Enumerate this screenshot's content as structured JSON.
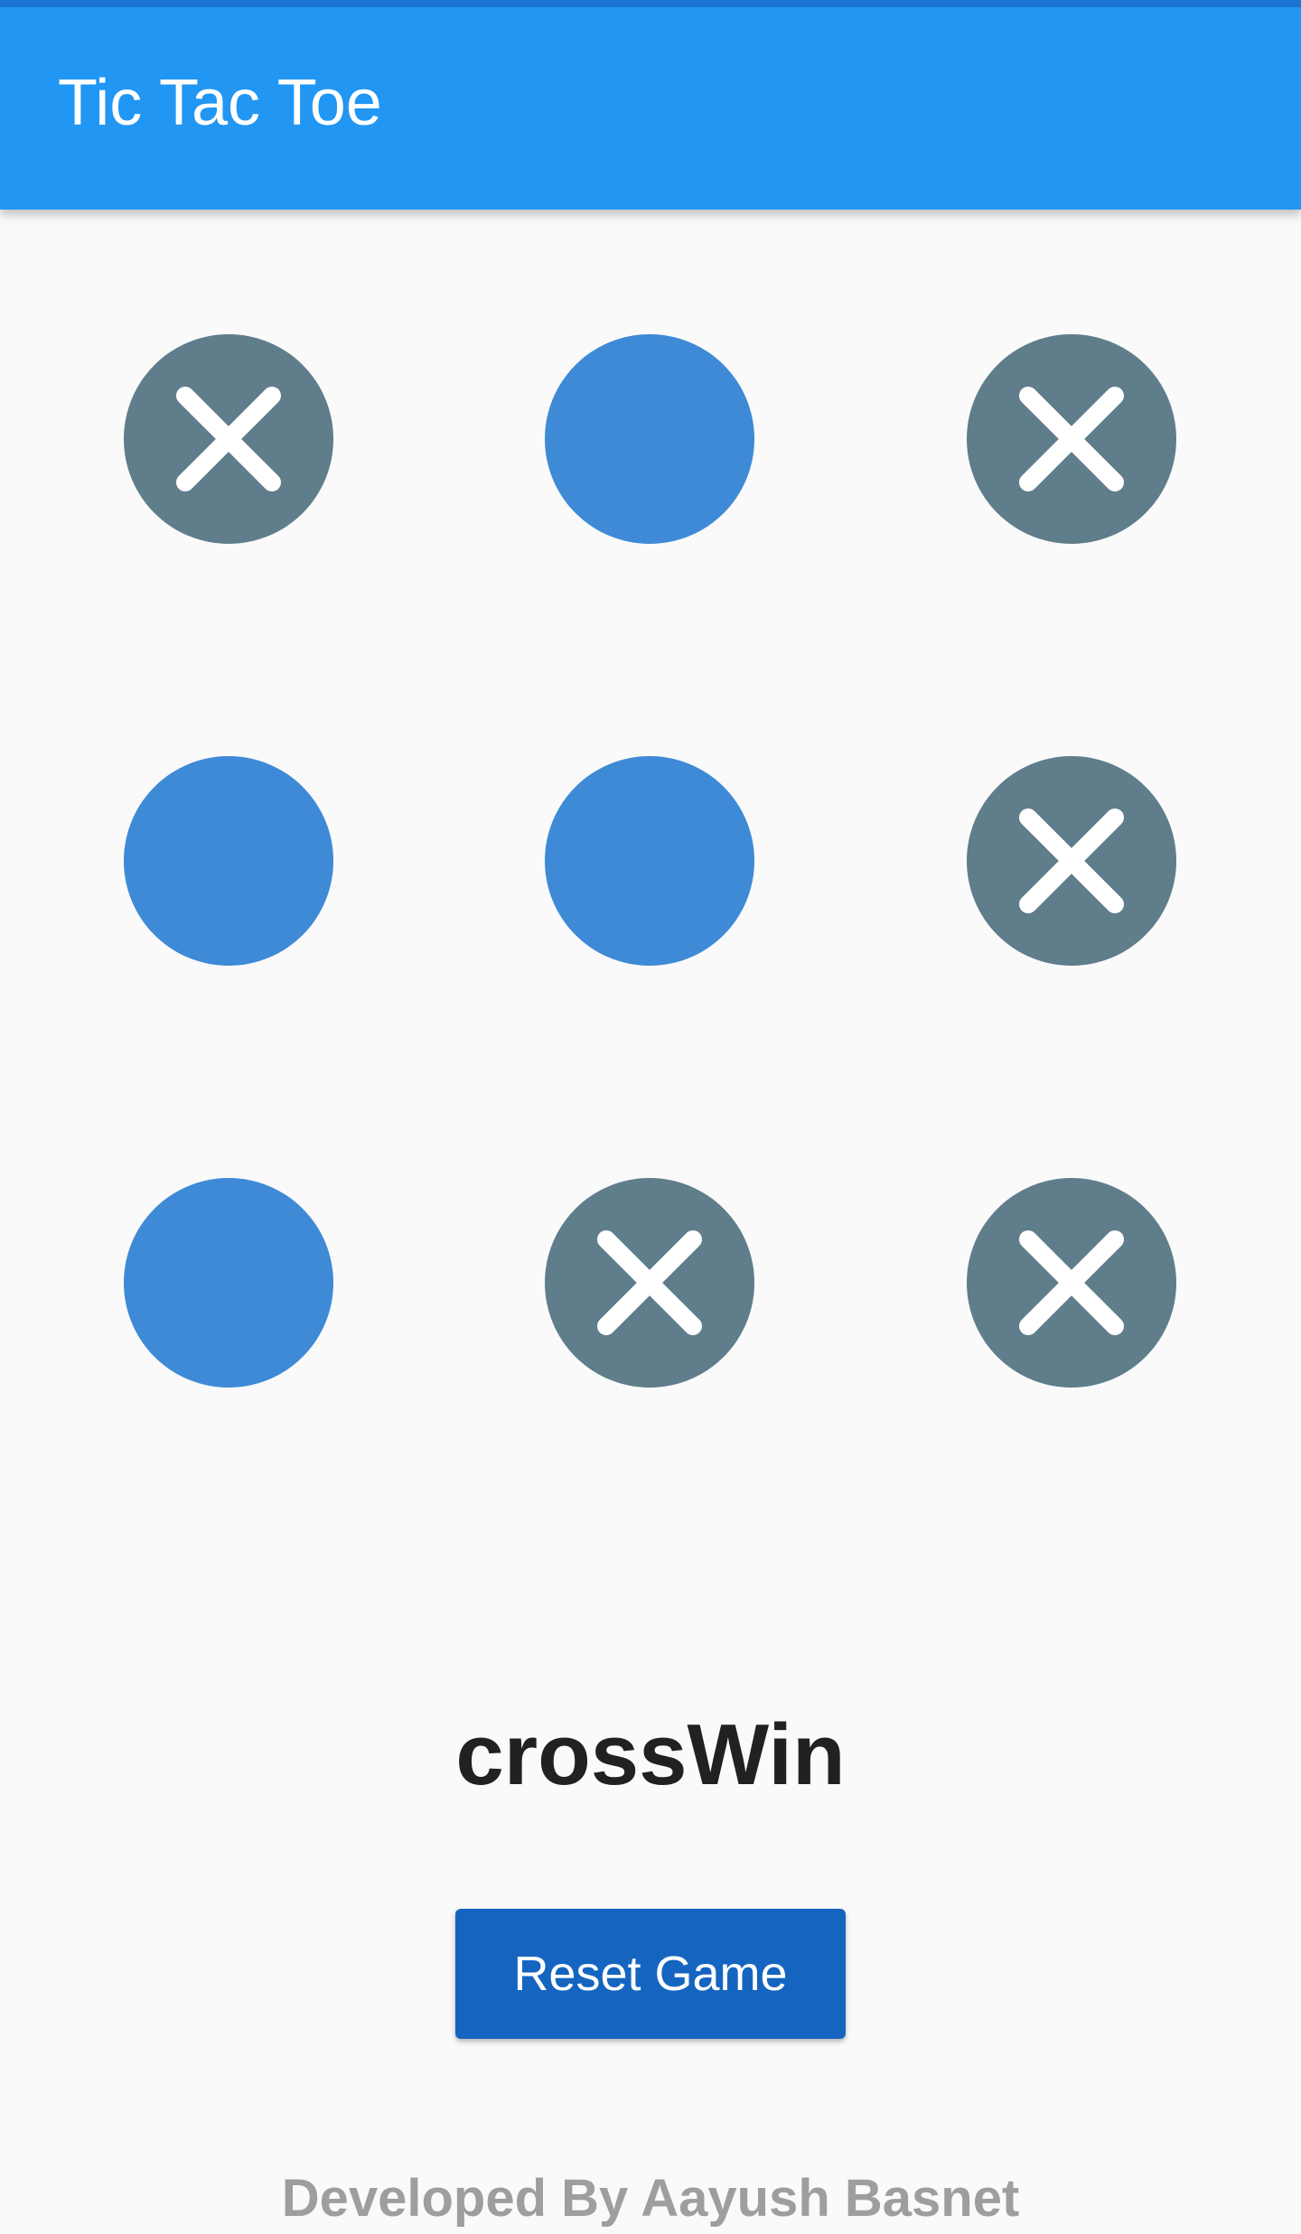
{
  "app_bar": {
    "title": "Tic Tac Toe",
    "color": "#2196f3"
  },
  "board": {
    "cells": [
      {
        "mark": "cross",
        "icon": "close-icon"
      },
      {
        "mark": "nought"
      },
      {
        "mark": "cross",
        "icon": "close-icon"
      },
      {
        "mark": "nought"
      },
      {
        "mark": "nought"
      },
      {
        "mark": "cross",
        "icon": "close-icon"
      },
      {
        "mark": "nought"
      },
      {
        "mark": "cross",
        "icon": "close-icon"
      },
      {
        "mark": "cross",
        "icon": "close-icon"
      }
    ],
    "colors": {
      "nought": "#3e8ad6",
      "cross": "#607d8b"
    }
  },
  "status": {
    "text": "crossWin"
  },
  "reset_button": {
    "label": "Reset Game",
    "color": "#1565c0"
  },
  "footer": {
    "text": "Developed By Aayush Basnet"
  }
}
